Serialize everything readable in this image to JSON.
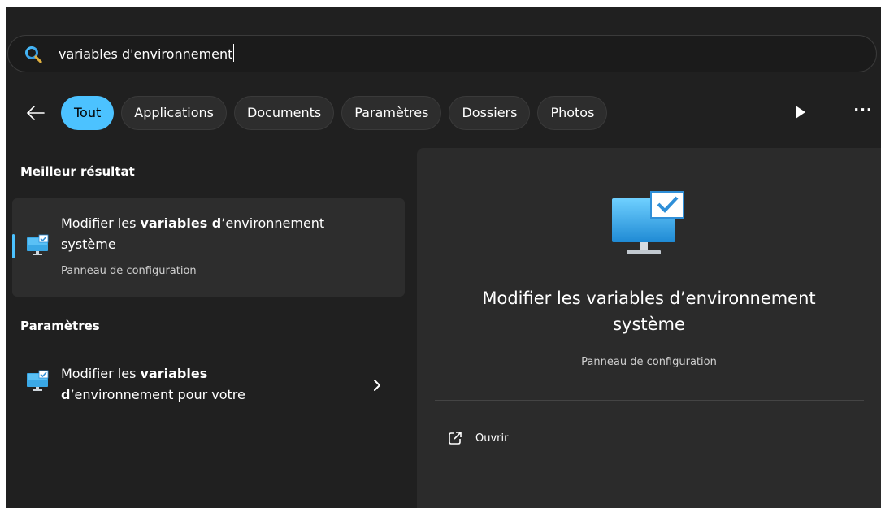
{
  "search": {
    "query": "variables d'environnement"
  },
  "filters": {
    "chips": [
      {
        "label": "Tout",
        "active": true
      },
      {
        "label": "Applications",
        "active": false
      },
      {
        "label": "Documents",
        "active": false
      },
      {
        "label": "Paramètres",
        "active": false
      },
      {
        "label": "Dossiers",
        "active": false
      },
      {
        "label": "Photos",
        "active": false
      }
    ],
    "more_label": "···"
  },
  "best_match": {
    "section_title": "Meilleur résultat",
    "title_part1": "Modifier les ",
    "title_bold1": "variables d",
    "title_part2": "’environnement",
    "title_line2": "système",
    "subtitle": "Panneau de configuration"
  },
  "settings": {
    "section_title": "Paramètres",
    "title_part1": "Modifier les ",
    "title_bold1": "variables",
    "title_bold2": "d",
    "title_part2": "’environnement pour votre"
  },
  "detail": {
    "title": "Modifier les variables d’environnement système",
    "subtitle": "Panneau de configuration",
    "action_label": "Ouvrir"
  },
  "colors": {
    "accent": "#4cc2ff",
    "background": "#202020",
    "card": "#2d2d2d"
  }
}
